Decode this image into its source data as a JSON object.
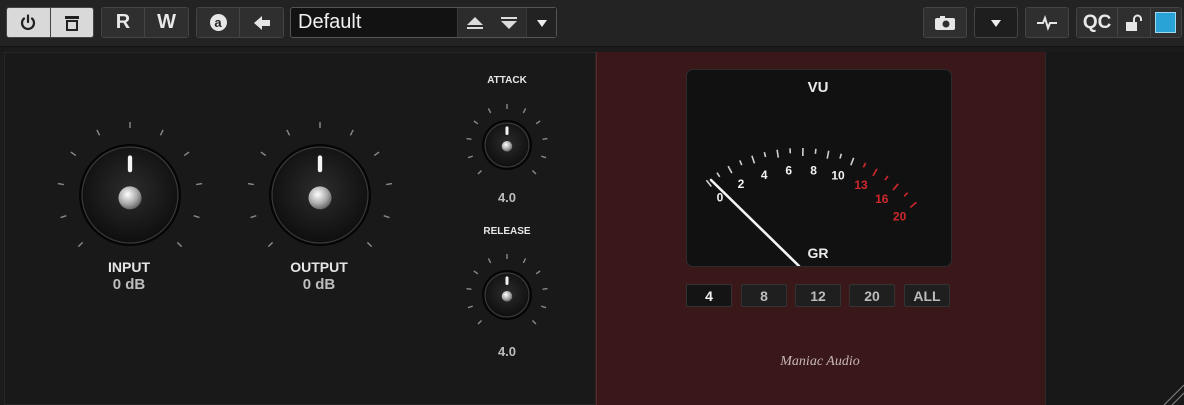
{
  "toolbar": {
    "read_label": "R",
    "write_label": "W",
    "auto_label": "a",
    "preset_name": "Default",
    "qc_label": "QC"
  },
  "controls": {
    "input": {
      "label": "INPUT",
      "value": "0 dB"
    },
    "output": {
      "label": "OUTPUT",
      "value": "0 dB"
    },
    "attack": {
      "label": "ATTACK",
      "value": "4.0"
    },
    "release": {
      "label": "RELEASE",
      "value": "4.0"
    }
  },
  "meter": {
    "title": "VU",
    "subtitle": "GR",
    "scale_labels": [
      "0",
      "2",
      "4",
      "6",
      "8",
      "10",
      "13",
      "16",
      "20"
    ],
    "red_from_index": 6,
    "colors": {
      "white": "#f2f2f2",
      "red": "#d0282c",
      "red_panel": "#3a1718",
      "status_blue": "#29a3d6"
    }
  },
  "ratio_buttons": [
    "4",
    "8",
    "12",
    "20",
    "ALL"
  ],
  "ratio_selected": "4",
  "brand": "Maniac Audio"
}
